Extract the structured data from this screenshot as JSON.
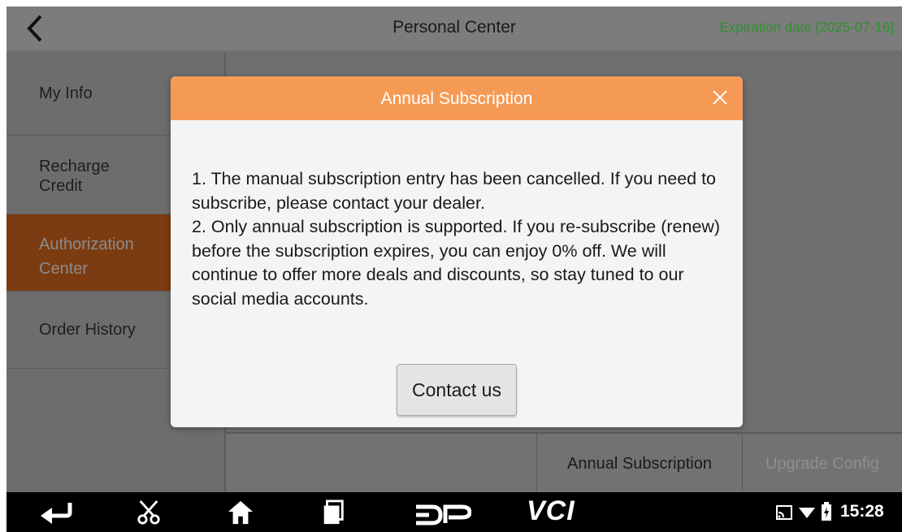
{
  "header": {
    "title": "Personal Center",
    "expiration": "Expiration date [2025-07-16]",
    "back_icon": "chevron-left-icon"
  },
  "sidebar": {
    "items": [
      {
        "label": "My Info",
        "active": false
      },
      {
        "label": "Recharge\nCredit",
        "active": false
      },
      {
        "label": "Authorization\nCenter",
        "active": true
      },
      {
        "label": "Order History",
        "active": false
      }
    ]
  },
  "tabs": {
    "annual": "Annual Subscription",
    "upgrade": "Upgrade Config"
  },
  "modal": {
    "title": "Annual Subscription",
    "body": "1. The manual subscription entry has been cancelled. If you need to subscribe, please contact your dealer.\n2. Only annual subscription is supported. If you re-subscribe (renew) before the subscription expires, you can enjoy 0% off. We will continue to offer more deals and discounts, so stay tuned to our social media accounts.",
    "contact_button": "Contact us",
    "close_icon": "close-icon"
  },
  "navbar": {
    "icons": [
      "back-arrow-icon",
      "scissors-icon",
      "home-icon",
      "recent-apps-icon",
      "dp-logo-icon",
      "vci-icon"
    ],
    "vci_label": "VCI",
    "time": "15:28",
    "status_icons": [
      "cast-icon",
      "wifi-icon",
      "battery-icon"
    ]
  },
  "colors": {
    "modal_header": "#f59a55",
    "active_sidebar": "#7c3c12",
    "expiration_text": "#2f8f2f"
  }
}
